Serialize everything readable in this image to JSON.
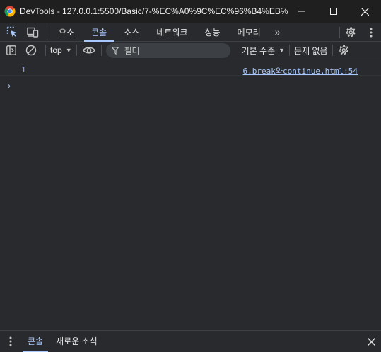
{
  "window": {
    "title": "DevTools - 127.0.0.1:5500/Basic/7-%EC%A0%9C%EC%96%B4%EB%..."
  },
  "tabs": [
    {
      "label": "요소"
    },
    {
      "label": "콘솔"
    },
    {
      "label": "소스"
    },
    {
      "label": "네트워크"
    },
    {
      "label": "성능"
    },
    {
      "label": "메모리"
    }
  ],
  "tabs_more": "»",
  "console_toolbar": {
    "context": "top",
    "filter_placeholder": "필터",
    "levels": "기본 수준",
    "issues": "문제 없음"
  },
  "console": {
    "messages": [
      {
        "value": "1",
        "source": "6.break와continue.html:54"
      }
    ],
    "prompt": "›"
  },
  "drawer": {
    "tabs": [
      {
        "label": "콘솔"
      },
      {
        "label": "새로운 소식"
      }
    ]
  },
  "colors": {
    "accent": "#a8c7fa",
    "background": "#282a2e",
    "titlebar": "#1f1f1f",
    "number": "#9aa0ff"
  },
  "icons": [
    "chrome-logo-icon",
    "minimize-icon",
    "maximize-icon",
    "close-icon",
    "inspect-element-icon",
    "device-toggle-icon",
    "settings-gear-icon",
    "kebab-menu-icon",
    "sidebar-toggle-icon",
    "clear-console-icon",
    "eye-icon",
    "filter-funnel-icon",
    "caret-down-icon"
  ]
}
